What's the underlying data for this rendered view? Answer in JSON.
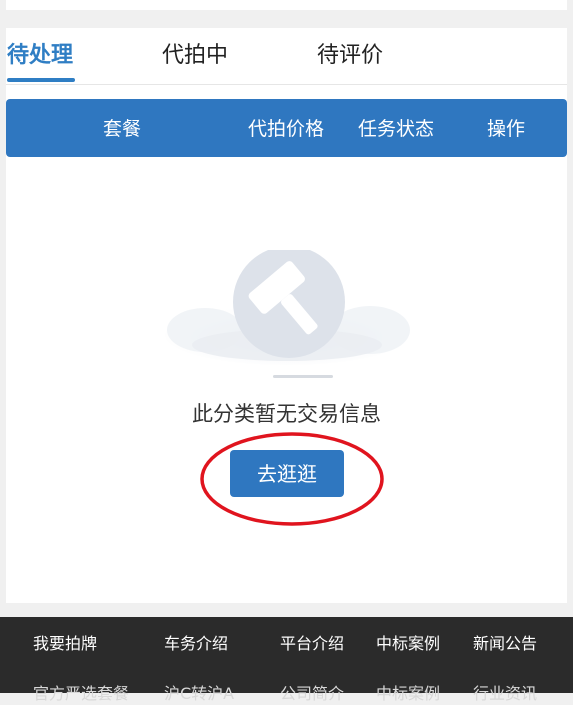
{
  "tabs": [
    {
      "label": "待处理",
      "active": true
    },
    {
      "label": "代拍中",
      "active": false
    },
    {
      "label": "待评价",
      "active": false
    }
  ],
  "table_header": {
    "columns": [
      "套餐",
      "代拍价格",
      "任务状态",
      "操作"
    ]
  },
  "empty_state": {
    "icon": "auction-hammer-icon",
    "message": "此分类暂无交易信息",
    "button_label": "去逛逛"
  },
  "footer": {
    "row1": [
      "我要拍牌",
      "车务介绍",
      "平台介绍",
      "中标案例",
      "新闻公告"
    ],
    "row2": [
      "官方严选套餐",
      "沪C转沪A",
      "公司简介",
      "中标案例",
      "行业资讯"
    ]
  },
  "colors": {
    "accent": "#2f7ec4",
    "header_bg": "#2f77c0",
    "footer_bg": "#2b2b2b",
    "annotation_ring": "#e0141e"
  }
}
